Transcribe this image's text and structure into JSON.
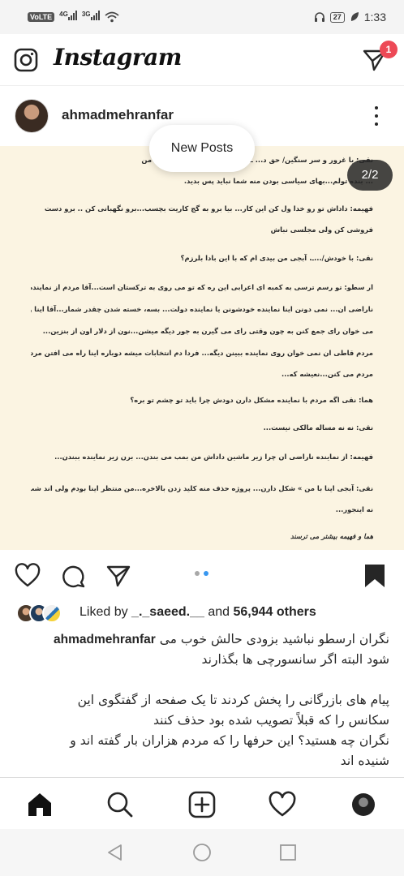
{
  "status_bar": {
    "volte": "VoLTE",
    "network_1": "4G",
    "network_2": "3G",
    "battery": "27",
    "time": "1:33"
  },
  "header": {
    "app_name": "Instagram",
    "dm_badge_count": "1",
    "icons": [
      "camera-icon",
      "direct-message-icon"
    ]
  },
  "post": {
    "username": "ahmadmehranfar",
    "new_posts_label": "New Posts",
    "carousel_counter": "2/2",
    "carousel_position": {
      "current": 2,
      "total": 2
    },
    "image_text_lines": [
      "نقی: با غرور و سر سنگین/ حق د... ـم سیاه... سیاست بی رحمه.. من",
      "... بنده تولم‌...بهای سیاسی بودن منه شما نباید پس بدید.",
      "فهیمه: داداش تو رو خدا ول کن این کار... بیا برو به گج کاریت بچسب...برو نگهبانی کن .. برو دست",
      "فروشی کن ولی مجلسی نباش",
      "نقی: با خودش/...ـ. آبجی من بیدی ام که با این بادا بلرزم؟",
      "ار سطو: تو رسم ترسی به کمبه ای اعرابی این ره که تو می روی به ترکستان است...آقا مردم از نماینده ها",
      "ناراضی ان... نمی دونن اینا نماینده خودشونن یا نماینده دولت... بسه، خسته شدن چقدر شمار...آقا اینا وقتی",
      "می خوان رای جمع کنن به چون وقتی رای می گیرن به جور دیگه میشن...نون از دلار اون از بنزین...",
      "مردم قاطی ان نمی خوان روی نماینده ببینن دیگه... فردا دم انتخابات میشه دوباره اینا راه می افتن مردم",
      "مردم می کنن...نعیشه که...",
      "هما: نقی اگه مردم با نماینده مشکل دارن دودش چرا باید تو چشم تو بره؟",
      "نقی: نه نه مساله مالکی نیست...",
      "فهیمه: از نماینده ناراضی ان چرا زیر ماشین داداش من بمب می بندن... برن زیر نماینده ببندن...",
      "نقی: آبجی اینا با من » شکل دارن... پروژه حذف منه کلید زدن بالاخره...من منتظر اینا بودم ولی اند شب»",
      "نه اینجور...",
      "هما و فهیمه بیشتر می ترسند"
    ],
    "liked_by_prefix": "Liked by ",
    "liked_by_user": "_._saeed.__",
    "liked_by_mid": " and ",
    "liked_by_count": "56,944 others",
    "caption_username": "ahmadmehranfar",
    "caption_line_1": "نگران ارسطو نباشید بزودی حالش خوب می",
    "caption_line_2": "شود البته اگر سانسورچی ها بگذارند",
    "caption_line_3": "پیام های بازرگانی را پخش کردند تا یک  صفحه از گفتگوی این",
    "caption_line_4": "سکانس را  که قبلاً تصویب شده بود حذف کنند",
    "caption_line_5": "نگران  چه هستید؟ این حرفها را که مردم هزاران بار گفته اند و",
    "caption_line_6": "شنیده اند"
  },
  "colors": {
    "accent_blue": "#3897f0",
    "badge_red": "#ed4956",
    "image_bg": "#fbf4e2"
  }
}
